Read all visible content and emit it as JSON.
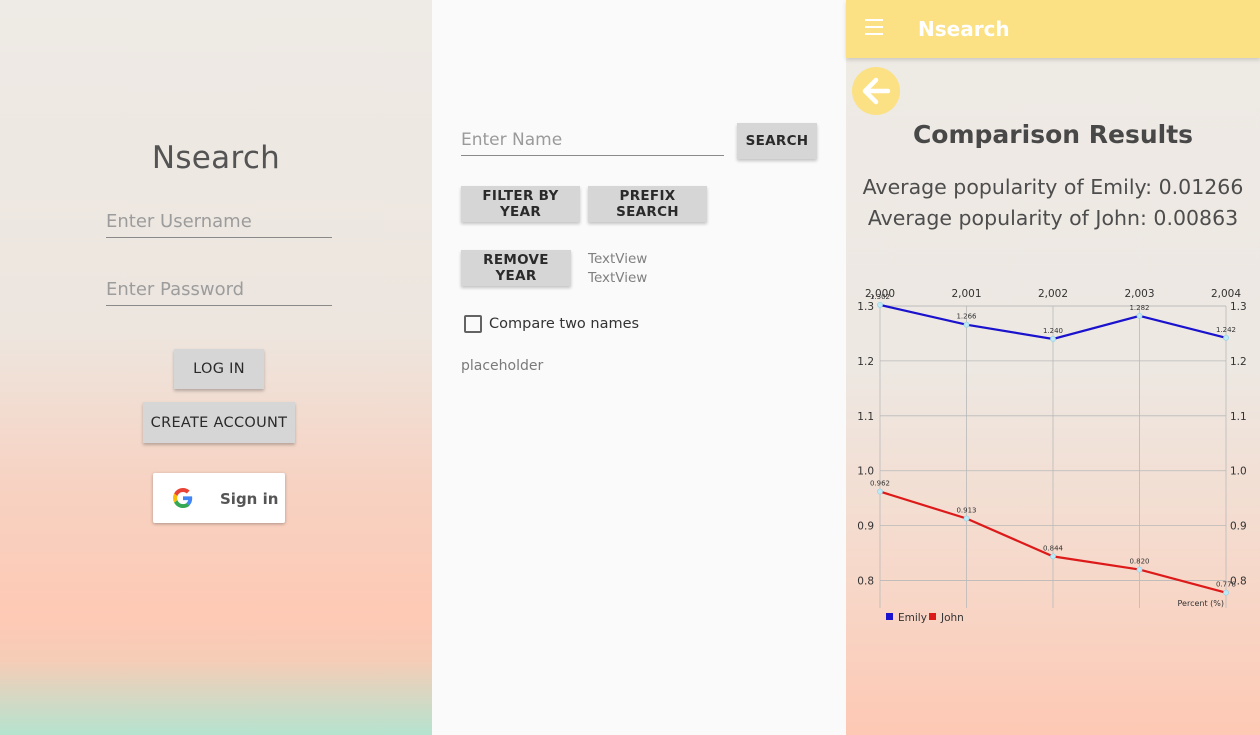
{
  "login": {
    "title": "Nsearch",
    "username_placeholder": "Enter Username",
    "password_placeholder": "Enter Password",
    "login_label": "LOG IN",
    "create_account_label": "CREATE ACCOUNT",
    "google_signin_label": "Sign in"
  },
  "search": {
    "name_placeholder": "Enter Name",
    "search_label": "SEARCH",
    "filter_year_label": "FILTER BY YEAR",
    "prefix_search_label": "PREFIX SEARCH",
    "remove_year_label": "REMOVE YEAR",
    "textview_1": "TextView",
    "textview_2": "TextView",
    "compare_label": "Compare two names",
    "compare_checked": false,
    "placeholder_text": "placeholder"
  },
  "results": {
    "app_title": "Nsearch",
    "heading": "Comparison Results",
    "avg_emily": "Average popularity of Emily: 0.01266",
    "avg_john": "Average popularity of John: 0.00863",
    "colors": {
      "appbar": "#fbe183",
      "emily": "#1a12cc",
      "john": "#dd1a1a"
    }
  },
  "chart_data": {
    "type": "line",
    "x": [
      2000,
      2001,
      2002,
      2003,
      2004
    ],
    "x_tick_labels": [
      "2,000",
      "2,001",
      "2,002",
      "2,003",
      "2,004"
    ],
    "ylim": [
      0.75,
      1.3
    ],
    "y_ticks": [
      0.8,
      0.9,
      1.0,
      1.1,
      1.2,
      1.3
    ],
    "series": [
      {
        "name": "Emily",
        "color": "#1a12cc",
        "values": [
          1.302,
          1.266,
          1.24,
          1.282,
          1.242
        ],
        "value_labels": [
          "1.302",
          "1.266",
          "1.240",
          "1.282",
          "1.242"
        ]
      },
      {
        "name": "John",
        "color": "#dd1a1a",
        "values": [
          0.962,
          0.913,
          0.844,
          0.82,
          0.778
        ],
        "value_labels": [
          "0.962",
          "0.913",
          "0.844",
          "0.820",
          "0.778"
        ]
      }
    ],
    "axis_note": "Percent (%)",
    "grid": true,
    "legend": "bottom-left"
  }
}
